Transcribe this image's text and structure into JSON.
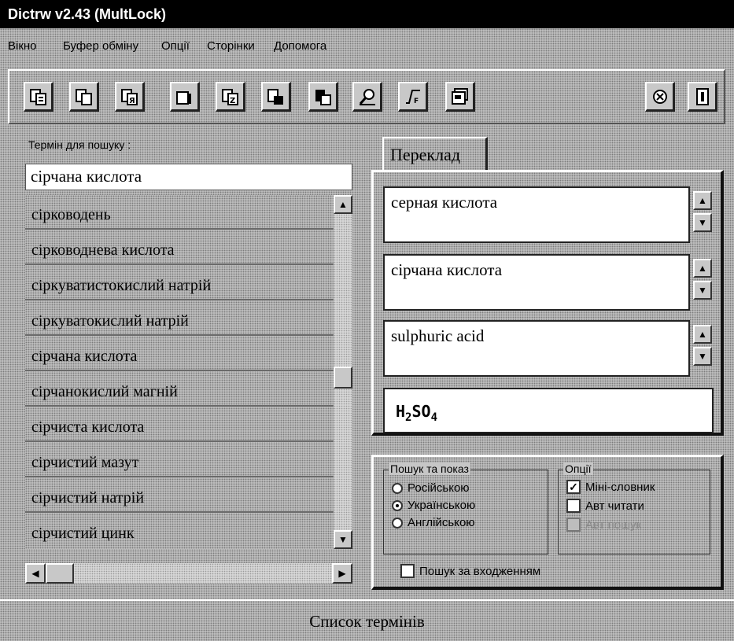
{
  "window": {
    "title": "Dictrw v2.43 (MultLock)"
  },
  "menu": [
    "Вікно",
    "Буфер обміну",
    "Опції",
    "Сторінки",
    "Допомога"
  ],
  "toolbar": {
    "buttons": [
      "copy-to-search",
      "copy",
      "paste-ru",
      "paste-ua",
      "paste-en",
      "copy-translation",
      "paste-translation",
      "find",
      "formula",
      "card",
      "refresh",
      "info"
    ]
  },
  "search": {
    "label": "Термін для пошуку :",
    "value": "сірчана кислота",
    "results": [
      "сірководень",
      "сірководнева кислота",
      "сіркуватистокислий натрій",
      "сіркуватокислий натрій",
      "сірчана кислота",
      "сірчанокислий магній",
      "сірчиста кислота",
      "сірчистий мазут",
      "сірчистий натрій",
      "сірчистий цинк"
    ]
  },
  "translation": {
    "tab_label": "Переклад",
    "ru": "серная кислота",
    "ua": "сірчана кислота",
    "en": "sulphuric acid",
    "formula": {
      "h": "H",
      "h_sub": "2",
      "s": "SO",
      "o_sub": "4"
    }
  },
  "options": {
    "search_group_title": "Пошук та показ",
    "radios": [
      {
        "label": "Російською",
        "checked": false
      },
      {
        "label": "Українською",
        "checked": true
      },
      {
        "label": "Англійською",
        "checked": false
      }
    ],
    "opts_group_title": "Опції",
    "checks": [
      {
        "label": "Міні-словник",
        "checked": true,
        "enabled": true
      },
      {
        "label": "Авт читати",
        "checked": false,
        "enabled": true
      },
      {
        "label": "Авт пошук",
        "checked": false,
        "enabled": false
      }
    ],
    "search_by_entry": {
      "label": "Пошук за входженням",
      "checked": false
    }
  },
  "status": {
    "text": "Список термінів"
  }
}
